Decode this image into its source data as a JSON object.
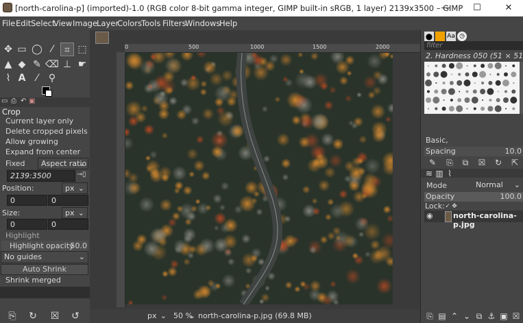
{
  "window": {
    "title": "[north-carolina-p] (imported)-1.0 (RGB color 8-bit gamma integer, GIMP built-in sRGB, 1 layer) 2139x3500 – GIMP",
    "minimize": "—",
    "maximize": "☐",
    "close": "✕"
  },
  "menubar": [
    "File",
    "Edit",
    "Select",
    "View",
    "Image",
    "Layer",
    "Colors",
    "Tools",
    "Filters",
    "Windows",
    "Help"
  ],
  "toolbox": {
    "tools": [
      "move-icon",
      "rect-select-icon",
      "lasso-icon",
      "fuzzy-select-icon",
      "crop-icon",
      "transform-icon",
      "warp-icon",
      "fill-icon",
      "paintbrush-icon",
      "eraser-icon",
      "clone-icon",
      "smudge-icon",
      "path-icon",
      "text-icon",
      "color-picker-icon",
      "zoom-icon"
    ]
  },
  "tool_options": {
    "title": "Crop",
    "current_layer_only": "Current layer only",
    "delete_cropped": "Delete cropped pixels",
    "allow_growing": "Allow growing",
    "expand_center": "Expand from center",
    "fixed": "Fixed",
    "aspect_ratio": "Aspect ratio",
    "ratio_value": "2139:3500",
    "position_label": "Position:",
    "position_unit": "px",
    "position_x": "0",
    "position_y": "0",
    "size_label": "Size:",
    "size_unit": "px",
    "size_x": "0",
    "size_y": "0",
    "highlight": "Highlight",
    "highlight_opacity_label": "Highlight opacity",
    "highlight_opacity_value": "50.0",
    "guides": "No guides",
    "auto_shrink": "Auto Shrink",
    "shrink_merged": "Shrink merged"
  },
  "rulers": {
    "top": [
      "0",
      "500",
      "1000",
      "1500",
      "2000"
    ]
  },
  "statusbar": {
    "unit": "px",
    "zoom": "50 %",
    "file": "north-carolina-p.jpg (69.8 MB)"
  },
  "brushes": {
    "filter_placeholder": "filter",
    "current": "2. Hardness 050 (51 × 51)",
    "preset": "Basic,",
    "spacing_label": "Spacing",
    "spacing_value": "10.0"
  },
  "layers": {
    "mode_label": "Mode",
    "mode_value": "Normal",
    "opacity_label": "Opacity",
    "opacity_value": "100.0",
    "lock_label": "Lock:",
    "layer_name": "north-carolina-p.jpg"
  },
  "colors": {
    "accent": "#f0a000",
    "road": "#4f5152",
    "forest_dark": "#2b3529"
  }
}
